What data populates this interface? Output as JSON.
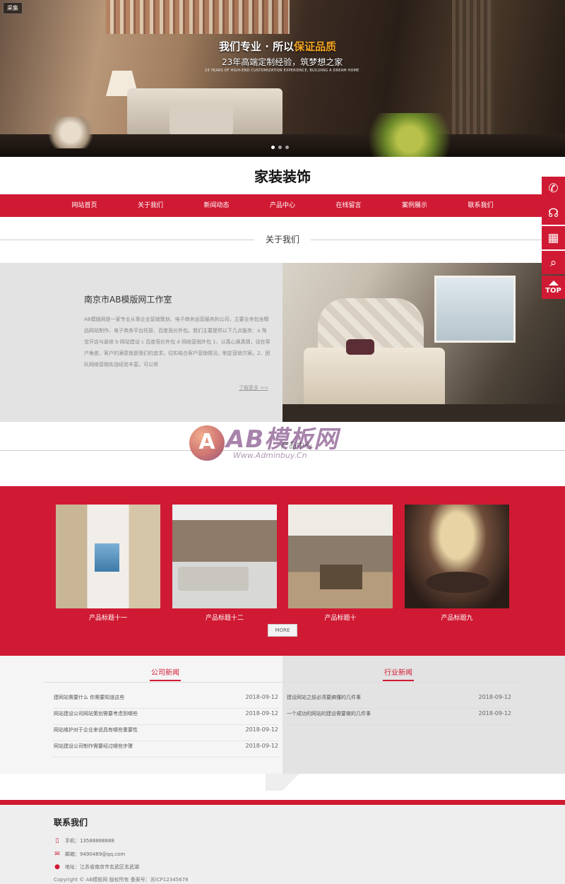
{
  "hero": {
    "tag": "采集",
    "title_pre": "我们专业 · 所以",
    "title_highlight": "保证品质",
    "subtitle": "23年高端定制经验，筑梦想之家",
    "subtitle_en": "23 YEARS OF HIGH-END CUSTOMIZATION EXPERIENCE, BUILDING A DREAM HOME"
  },
  "logo": "家装装饰",
  "nav": [
    "网站首页",
    "关于我们",
    "新闻动态",
    "产品中心",
    "在线留言",
    "案例展示",
    "联系我们"
  ],
  "about": {
    "section_title": "关于我们",
    "heading": "南京市AB模版网工作室",
    "text": "AB模版网是一家专业从事企业营销策划、电子商务运营服务的公司，主要业务包含精品网站制作、电子商务平台托管、百度竞价外包。我们主要提供以下几点服务：a 淘宝开店与装修 b 网站建设 c 百度竞价外包 d 网络营销外包 1、以真心换真情，站在客户角度，客户的满意就是我们的追求，切实结合客户营销情况，制定营销方案。2、团队网络营销实战经验丰富，可以将",
    "more": "了解更多 >>"
  },
  "watermark": {
    "big": "AB模板网",
    "small": "Www.Adminbuy.Cn",
    "small2": "产品中心"
  },
  "products": {
    "items": [
      {
        "caption": "产品标题十一"
      },
      {
        "caption": "产品标题十二"
      },
      {
        "caption": "产品标题十"
      },
      {
        "caption": "产品标题九"
      }
    ],
    "more": "MORE"
  },
  "news": {
    "company": {
      "title": "公司新闻",
      "items": [
        {
          "title": "建网站需要什么 你需要知道这些",
          "date": "2018-09-12"
        },
        {
          "title": "网站建设公司网站策划需要考虑到哪些",
          "date": "2018-09-12"
        },
        {
          "title": "网站维护对于企业来说具有哪些重要性",
          "date": "2018-09-12"
        },
        {
          "title": "网站建设公司制作需要经过哪些步骤",
          "date": "2018-09-12"
        }
      ]
    },
    "industry": {
      "title": "行业新闻",
      "items": [
        {
          "title": "建设网站之前必须要搞懂的几件事",
          "date": "2018-09-12"
        },
        {
          "title": "一个成功的网站的建设需要做的几件事",
          "date": "2018-09-12"
        }
      ]
    }
  },
  "footer": {
    "title": "联系我们",
    "phone": "手机：13588888888",
    "email": "邮箱：9490489@qq.com",
    "address": "地址：江苏省南京市玄武区玄武湖",
    "copyright": "Copyright © AB模板网 版权所有 备案号：苏ICP12345678"
  },
  "side": {
    "top_label": "TOP"
  },
  "colors": {
    "accent": "#d01a33",
    "highlight": "#f5a623"
  }
}
